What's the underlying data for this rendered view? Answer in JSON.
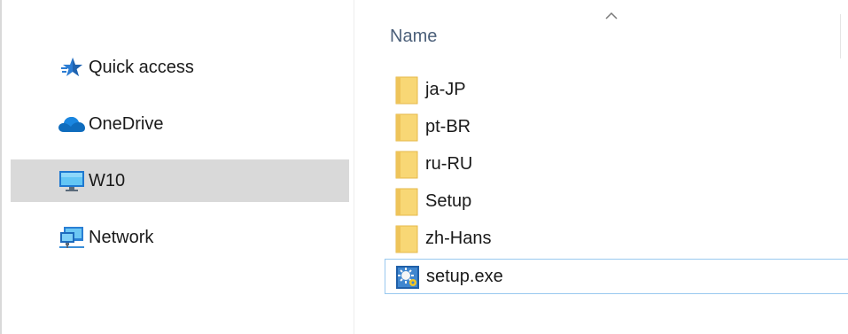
{
  "navigation": {
    "items": [
      {
        "label": "Quick access",
        "icon": "quick-access-star-icon",
        "selected": false
      },
      {
        "label": "OneDrive",
        "icon": "onedrive-cloud-icon",
        "selected": false
      },
      {
        "label": "W10",
        "icon": "computer-monitor-icon",
        "selected": true
      },
      {
        "label": "Network",
        "icon": "network-icon",
        "selected": false
      }
    ]
  },
  "file_list": {
    "column_header": "Name",
    "sort_indicator": "ascending",
    "items": [
      {
        "name": "ja-JP",
        "type": "folder"
      },
      {
        "name": "pt-BR",
        "type": "folder"
      },
      {
        "name": "ru-RU",
        "type": "folder"
      },
      {
        "name": "Setup",
        "type": "folder"
      },
      {
        "name": "zh-Hans",
        "type": "folder"
      },
      {
        "name": "setup.exe",
        "type": "application",
        "focused": true
      }
    ]
  },
  "colors": {
    "selection_bg": "#d9d9d9",
    "header_text": "#4c607a",
    "folder_body": "#f8d775",
    "focus_border": "#99c9ef"
  }
}
